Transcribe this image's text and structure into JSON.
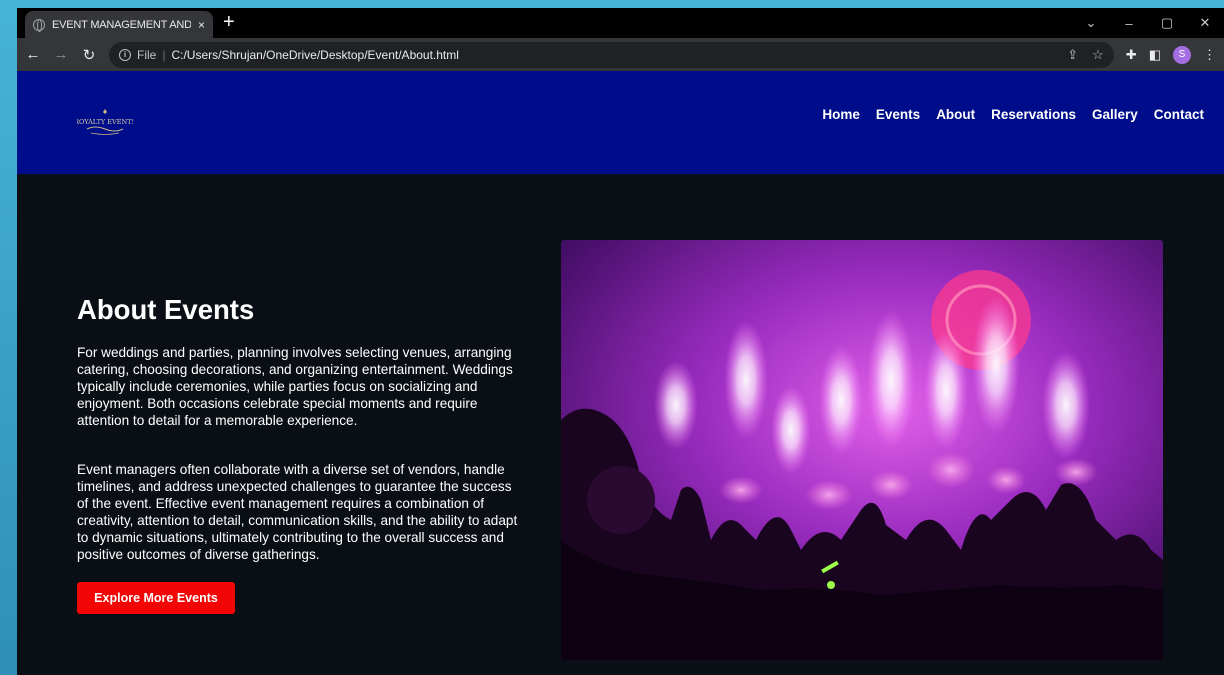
{
  "browser": {
    "tab_title": "EVENT MANAGEMENT AND TICKET",
    "tab_close": "×",
    "new_tab": "+",
    "file_label": "File",
    "url": "C:/Users/Shrujan/OneDrive/Desktop/Event/About.html",
    "profile_initial": "S",
    "window_controls": [
      "⌄",
      "–",
      "▢",
      "✕"
    ]
  },
  "site": {
    "logo_text": "ROYALTY EVENTS",
    "nav": [
      "Home",
      "Events",
      "About",
      "Reservations",
      "Gallery",
      "Contact"
    ]
  },
  "about": {
    "title": "About Events",
    "paragraph_1": "For weddings and parties, planning involves selecting venues, arranging catering, choosing decorations, and organizing entertainment. Weddings typically include ceremonies, while parties focus on socializing and enjoyment. Both occasions celebrate special moments and require attention to detail for a memorable experience.",
    "paragraph_2": "Event managers often collaborate with a diverse set of vendors, handle timelines, and address unexpected challenges to guarantee the success of the event. Effective event management requires a combination of creativity, attention to detail, communication skills, and the ability to adapt to dynamic situations, ultimately contributing to the overall success and positive outcomes of diverse gatherings.",
    "button_label": "Explore More Events"
  },
  "colors": {
    "header_bg": "#000d8a",
    "page_bg": "#0a0f16",
    "button_bg": "#f40505"
  }
}
